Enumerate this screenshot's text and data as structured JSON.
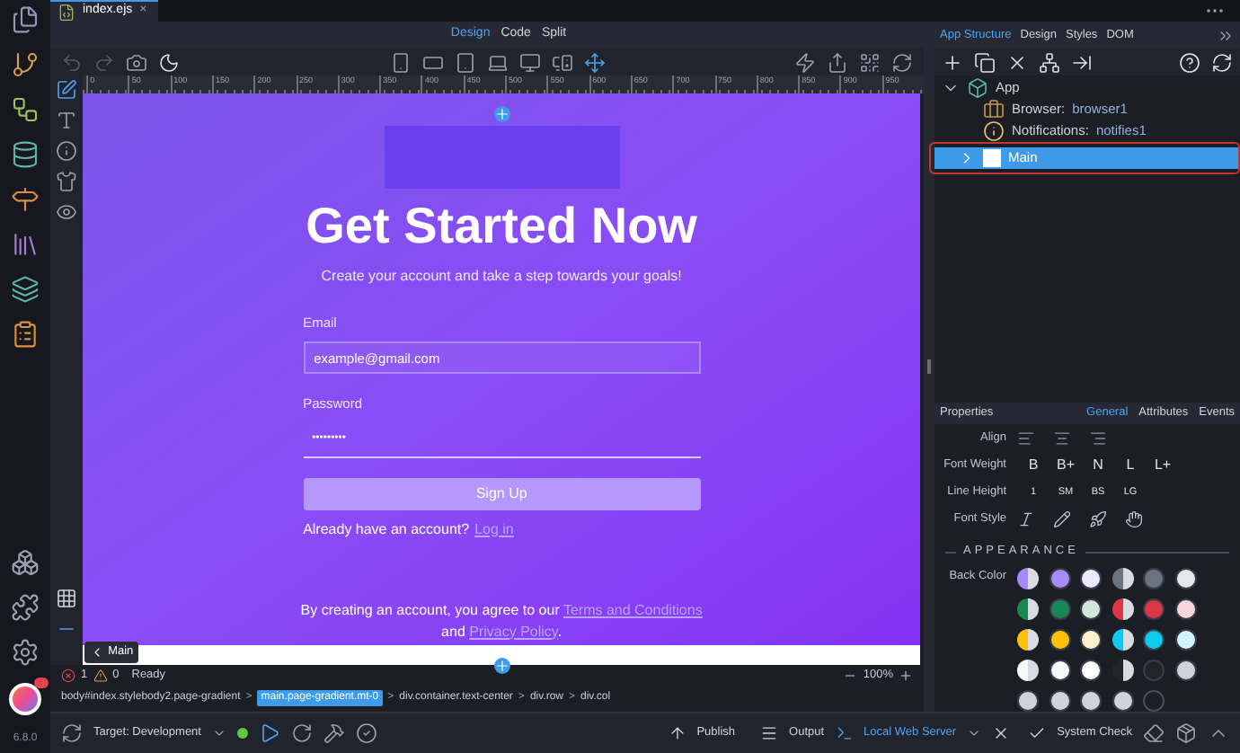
{
  "file_tab": {
    "label": "index.ejs",
    "close": "×"
  },
  "view_modes": [
    {
      "label": "Design",
      "selected": true
    },
    {
      "label": "Code",
      "selected": false
    },
    {
      "label": "Split",
      "selected": false
    }
  ],
  "ruler_ticks": [
    "0",
    "50",
    "100",
    "150",
    "200",
    "250",
    "300",
    "350",
    "400",
    "450",
    "500",
    "550",
    "600",
    "650",
    "700",
    "750",
    "800",
    "850",
    "900",
    "950"
  ],
  "canvas": {
    "title": "Get Started Now",
    "subtitle": "Create your account and take a step towards your goals!",
    "fields": [
      {
        "label": "Email",
        "value": "example@gmail.com",
        "kind": "boxed"
      },
      {
        "label": "Password",
        "value": "•••••••••",
        "kind": "underline"
      }
    ],
    "button": "Sign Up",
    "login_prompt": "Already have an account?",
    "login_link": "Log in",
    "terms": "By creating an account, you agree to our",
    "terms_link": "Terms and Conditions",
    "terms_and": "and",
    "privacy_link": "Privacy Policy",
    "period": "."
  },
  "element_tag": "Main",
  "status": {
    "errors": "1",
    "warnings": "0",
    "message": "Ready",
    "zoom": "100%"
  },
  "breadcrumb": [
    {
      "label": "body#index.stylebody2.page-gradient",
      "selected": false
    },
    {
      "separator": ">",
      "label": "main.page-gradient.mt-0",
      "selected": true
    },
    {
      "separator": ">",
      "label": "div.container.text-center",
      "selected": false
    },
    {
      "separator": ">",
      "label": "div.row",
      "selected": false
    },
    {
      "separator": ">",
      "label": "div.col",
      "selected": false
    }
  ],
  "bottom_bar": {
    "target": "Target: Development",
    "publish": "Publish",
    "output": "Output",
    "server": "Local Web Server",
    "system_check": "System Check"
  },
  "version": "6.8.0",
  "panel_tabs": [
    {
      "label": "App Structure",
      "selected": true
    },
    {
      "label": "Design",
      "selected": false
    },
    {
      "label": "Styles",
      "selected": false
    },
    {
      "label": "DOM",
      "selected": false
    }
  ],
  "tree": [
    {
      "label": "App",
      "expanded": true,
      "selected": false,
      "kind": "app",
      "children": [
        {
          "label": "Browser:",
          "value": "browser1",
          "kind": "browser",
          "selected": false
        },
        {
          "label": "Notifications:",
          "value": "notifies1",
          "kind": "notifications",
          "selected": false
        },
        {
          "label": "Main",
          "kind": "main",
          "expanded": false,
          "selected": true
        }
      ]
    }
  ],
  "properties": {
    "title": "Properties",
    "tabs": [
      {
        "label": "General",
        "selected": true
      },
      {
        "label": "Attributes",
        "selected": false
      },
      {
        "label": "Events",
        "selected": false
      }
    ],
    "rows": [
      {
        "label": "Align",
        "kind": "align"
      },
      {
        "label": "Font Weight",
        "kind": "options",
        "options": [
          "B",
          "B+",
          "N",
          "L",
          "L+"
        ]
      },
      {
        "label": "Line Height",
        "kind": "options",
        "options": [
          "1",
          "SM",
          "BS",
          "LG"
        ]
      },
      {
        "label": "Font Style",
        "kind": "styles"
      }
    ],
    "section": "APPEARANCE",
    "back_color_label": "Back Color",
    "swatches": [
      {
        "kind": "half",
        "color": "#a78bfa"
      },
      {
        "kind": "solid",
        "color": "#a78bfa"
      },
      {
        "kind": "solid",
        "color": "#ede9fe"
      },
      {
        "kind": "half",
        "color": "#6b7280"
      },
      {
        "kind": "solid",
        "color": "#6b7280"
      },
      {
        "kind": "solid",
        "color": "#e5e7eb"
      },
      {
        "kind": "half",
        "color": "#198754"
      },
      {
        "kind": "solid",
        "color": "#198754"
      },
      {
        "kind": "solid",
        "color": "#d1e7dd"
      },
      {
        "kind": "half",
        "color": "#dc3545"
      },
      {
        "kind": "solid",
        "color": "#dc3545"
      },
      {
        "kind": "solid",
        "color": "#f8d7da"
      },
      {
        "kind": "half",
        "color": "#ffc107"
      },
      {
        "kind": "solid",
        "color": "#ffc107"
      },
      {
        "kind": "solid",
        "color": "#fff3cd"
      },
      {
        "kind": "half",
        "color": "#0dcaf0"
      },
      {
        "kind": "solid",
        "color": "#0dcaf0"
      },
      {
        "kind": "solid",
        "color": "#cff4fc"
      },
      {
        "kind": "half",
        "color": "#f8f9fa"
      },
      {
        "kind": "solid",
        "color": "#f8f9fa"
      },
      {
        "kind": "solid",
        "color": "#ffffff"
      },
      {
        "kind": "half",
        "color": "#212529"
      },
      {
        "kind": "solid",
        "color": "#212529"
      },
      {
        "kind": "solid",
        "color": "#ced4da"
      },
      {
        "kind": "solid",
        "color": "#ced4da"
      },
      {
        "kind": "solid",
        "color": "#ced4da"
      },
      {
        "kind": "solid",
        "color": "#ced4da"
      },
      {
        "kind": "solid",
        "color": "#ced4da"
      },
      {
        "kind": "outline",
        "color": "#1c1e26"
      }
    ]
  }
}
